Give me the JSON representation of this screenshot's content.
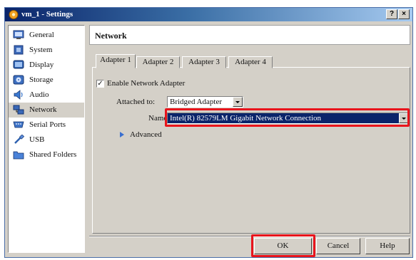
{
  "window": {
    "title": "vm_1 - Settings",
    "help_button": "?",
    "close_button": "×"
  },
  "sidebar": {
    "items": [
      {
        "label": "General",
        "icon": "general-icon",
        "selected": false
      },
      {
        "label": "System",
        "icon": "system-icon",
        "selected": false
      },
      {
        "label": "Display",
        "icon": "display-icon",
        "selected": false
      },
      {
        "label": "Storage",
        "icon": "storage-icon",
        "selected": false
      },
      {
        "label": "Audio",
        "icon": "audio-icon",
        "selected": false
      },
      {
        "label": "Network",
        "icon": "network-icon",
        "selected": true
      },
      {
        "label": "Serial Ports",
        "icon": "serial-ports-icon",
        "selected": false
      },
      {
        "label": "USB",
        "icon": "usb-icon",
        "selected": false
      },
      {
        "label": "Shared Folders",
        "icon": "shared-folders-icon",
        "selected": false
      }
    ]
  },
  "main": {
    "title": "Network",
    "tabs": [
      {
        "label": "Adapter 1",
        "active": true
      },
      {
        "label": "Adapter 2",
        "active": false
      },
      {
        "label": "Adapter 3",
        "active": false
      },
      {
        "label": "Adapter 4",
        "active": false
      }
    ],
    "enable_adapter": {
      "label": "Enable Network Adapter",
      "checked": true,
      "check_glyph": "✓"
    },
    "attached_to": {
      "label": "Attached to:",
      "value": "Bridged Adapter"
    },
    "name": {
      "label": "Name:",
      "value": "Intel(R) 82579LM Gigabit Network Connection"
    },
    "advanced": {
      "label": "Advanced"
    }
  },
  "buttons": {
    "ok": "OK",
    "cancel": "Cancel",
    "help": "Help"
  },
  "colors": {
    "highlight": "#e8141c",
    "selection": "#0a246a",
    "titlebar_start": "#0a246a"
  }
}
